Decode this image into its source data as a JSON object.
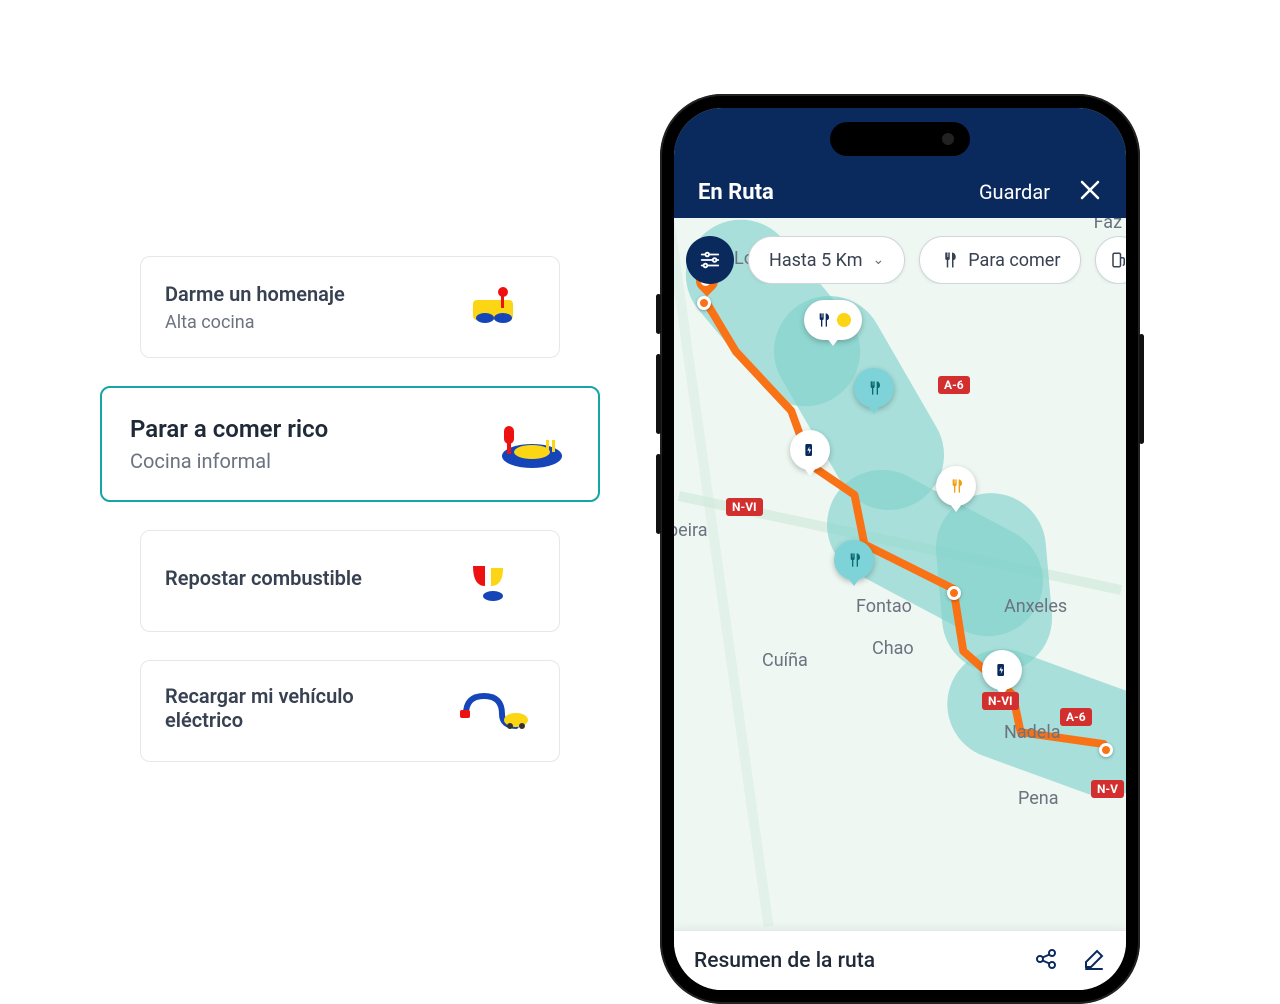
{
  "options": [
    {
      "title": "Darme un homenaje",
      "subtitle": "Alta cocina",
      "icon": "haute-cuisine-icon",
      "selected": false
    },
    {
      "title": "Parar a comer rico",
      "subtitle": "Cocina informal",
      "icon": "casual-food-icon",
      "selected": true
    },
    {
      "title": "Repostar combustible",
      "subtitle": "",
      "icon": "fuel-icon",
      "selected": false
    },
    {
      "title": "Recargar mi vehículo eléctrico",
      "subtitle": "",
      "icon": "ev-charge-icon",
      "selected": false
    }
  ],
  "app": {
    "title": "En Ruta",
    "save_label": "Guardar",
    "chips": {
      "distance": "Hasta 5 Km",
      "eat": "Para comer"
    },
    "sheet_title": "Resumen de la ruta"
  },
  "map": {
    "towns": [
      "Louzaneta",
      "Faz",
      "beira",
      "Fontao",
      "Anxeles",
      "Cuíña",
      "Chao",
      "Nadela",
      "Pena"
    ],
    "road_badges": [
      "A-6",
      "N-VI",
      "N-VI",
      "A-6",
      "N-V"
    ]
  },
  "colors": {
    "brand_navy": "#0a2a5e",
    "accent_teal": "#16a5a5",
    "route_orange": "#f97316",
    "road_red": "#d32f2f"
  }
}
